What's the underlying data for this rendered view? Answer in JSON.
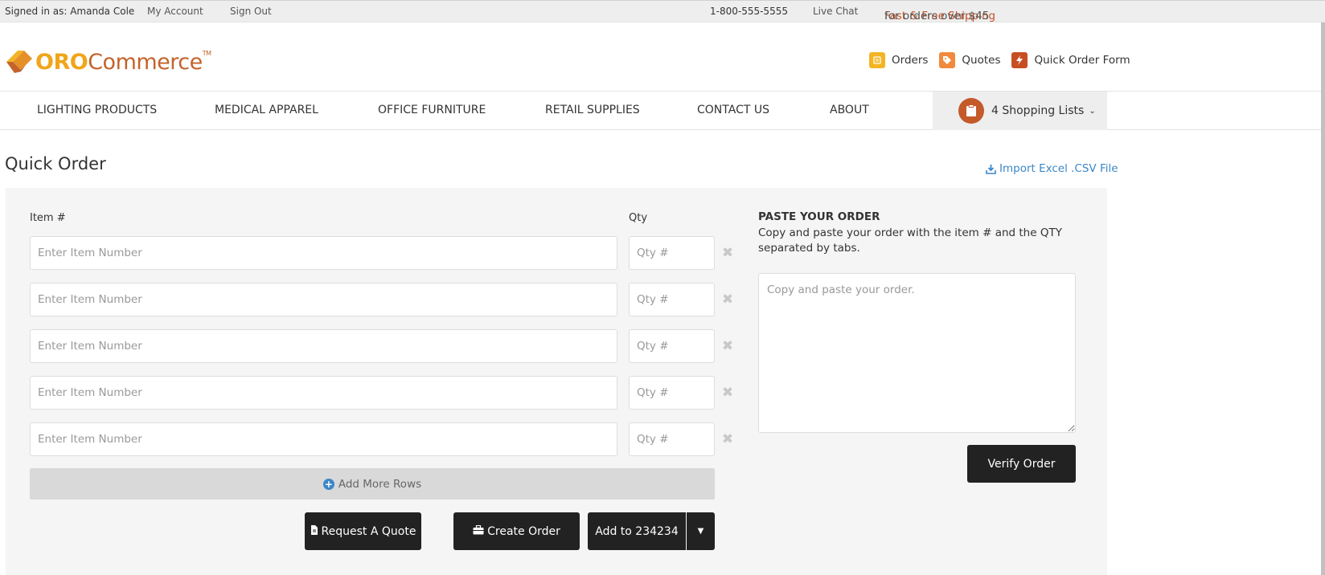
{
  "topbar": {
    "signed_in": "Signed in as: Amanda Cole",
    "my_account": "My Account",
    "sign_out": "Sign Out",
    "phone": "1-800-555-5555",
    "live_chat": "Live Chat",
    "shipping_highlight": "Fast & Free Shipping",
    "shipping_rest": " for orders over $45"
  },
  "header": {
    "logo_oro": "ORO",
    "logo_commerce": "Commerce",
    "logo_tm": "TM",
    "links": {
      "orders": "Orders",
      "quotes": "Quotes",
      "quick_order_form": "Quick Order Form"
    }
  },
  "nav": {
    "items": [
      "LIGHTING PRODUCTS",
      "MEDICAL APPAREL",
      "OFFICE FURNITURE",
      "RETAIL SUPPLIES",
      "CONTACT US",
      "ABOUT"
    ],
    "shopping_lists": "4 Shopping Lists"
  },
  "page": {
    "title": "Quick Order",
    "import_link": "Import Excel .CSV File"
  },
  "form": {
    "item_label": "Item #",
    "qty_label": "Qty",
    "item_placeholder": "Enter Item Number",
    "qty_placeholder": "Qty #",
    "add_more_rows": "Add More Rows",
    "request_quote": "Request A Quote",
    "create_order": "Create Order",
    "add_to": "Add to 234234"
  },
  "paste": {
    "title": "PASTE YOUR ORDER",
    "description": "Copy and paste your order with the item # and the QTY separated by tabs.",
    "placeholder": "Copy and paste your order.",
    "verify": "Verify Order"
  },
  "colors": {
    "accent_orange": "#c4532a",
    "logo_yellow": "#f0a51a",
    "link_blue": "#3b87c8",
    "button_dark": "#222222"
  }
}
